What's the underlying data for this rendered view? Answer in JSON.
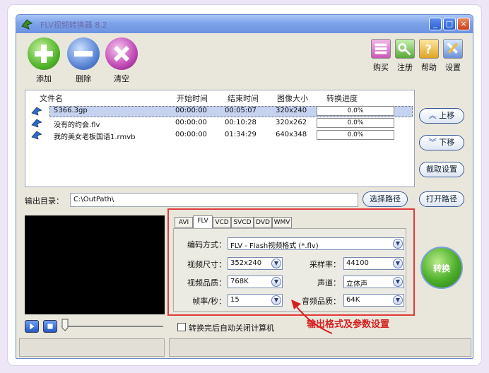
{
  "window": {
    "title": "FLV视频转换器 8.2",
    "min_glyph": "_",
    "max_glyph": "□",
    "close_glyph": "×"
  },
  "toolbar": {
    "add_label": "添加",
    "delete_label": "删除",
    "clear_label": "清空",
    "buy_label": "购买",
    "register_label": "注册",
    "help_label": "帮助",
    "settings_label": "设置"
  },
  "file_list": {
    "headers": {
      "name": "文件名",
      "start": "开始时间",
      "end": "结束时间",
      "size": "图像大小",
      "progress": "转换进度"
    },
    "rows": [
      {
        "name": "5366.3gp",
        "start": "00:00:00",
        "end": "00:05:07",
        "size": "320x240",
        "progress": "0.0%"
      },
      {
        "name": "没有的约会.flv",
        "start": "00:00:00",
        "end": "00:10:28",
        "size": "320x262",
        "progress": "0.0%"
      },
      {
        "name": "我的美女老板国语1.rmvb",
        "start": "00:00:00",
        "end": "01:34:29",
        "size": "640x348",
        "progress": "0.0%"
      }
    ]
  },
  "side_buttons": {
    "up": "上移",
    "down": "下移",
    "capture": "截取设置",
    "open_path": "打开路径"
  },
  "output": {
    "label": "输出目录：",
    "path": "C:\\OutPath\\",
    "choose": "选择路径"
  },
  "format_tabs": [
    "AVI",
    "FLV",
    "VCD",
    "SVCD",
    "DVD",
    "WMV"
  ],
  "params": {
    "codec_label": "编码方式：",
    "codec_value": "FLV - Flash视频格式 (*.flv)",
    "vsize_label": "视频尺寸：",
    "vsize_value": "352x240",
    "samplerate_label": "采样率：",
    "samplerate_value": "44100",
    "vquality_label": "视频品质：",
    "vquality_value": "768K",
    "channel_label": "声道：",
    "channel_value": "立体声",
    "fps_label": "帧率/秒：",
    "fps_value": "15",
    "aquality_label": "音频品质：",
    "aquality_value": "64K"
  },
  "convert_label": "转换",
  "shutdown_label": "转换完后自动关闭计算机",
  "annotation": "输出格式及参数设置",
  "colors": {
    "annotation": "#d4201f",
    "titlebar": "#7ea3ea"
  }
}
